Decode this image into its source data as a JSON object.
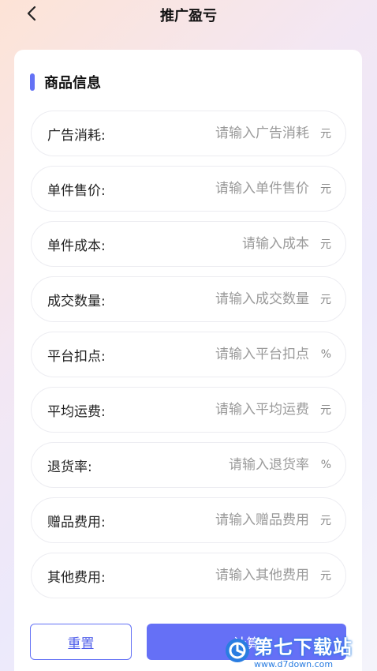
{
  "header": {
    "title": "推广盈亏"
  },
  "section": {
    "title": "商品信息"
  },
  "fields": [
    {
      "label": "广告消耗:",
      "placeholder": "请输入广告消耗",
      "unit": "元"
    },
    {
      "label": "单件售价:",
      "placeholder": "请输入单件售价",
      "unit": "元"
    },
    {
      "label": "单件成本:",
      "placeholder": "请输入成本",
      "unit": "元"
    },
    {
      "label": "成交数量:",
      "placeholder": "请输入成交数量",
      "unit": "元"
    },
    {
      "label": "平台扣点:",
      "placeholder": "请输入平台扣点",
      "unit": "%"
    },
    {
      "label": "平均运费:",
      "placeholder": "请输入平均运费",
      "unit": "元"
    },
    {
      "label": "退货率:",
      "placeholder": "请输入退货率",
      "unit": "%"
    },
    {
      "label": "赠品费用:",
      "placeholder": "请输入赠品费用",
      "unit": "元"
    },
    {
      "label": "其他费用:",
      "placeholder": "请输入其他费用",
      "unit": "元"
    }
  ],
  "buttons": {
    "reset": "重置",
    "calculate": "计算"
  },
  "watermark": {
    "text": "第七下载站",
    "url": "www.d7down.com"
  },
  "colors": {
    "accent": "#6472f5"
  }
}
